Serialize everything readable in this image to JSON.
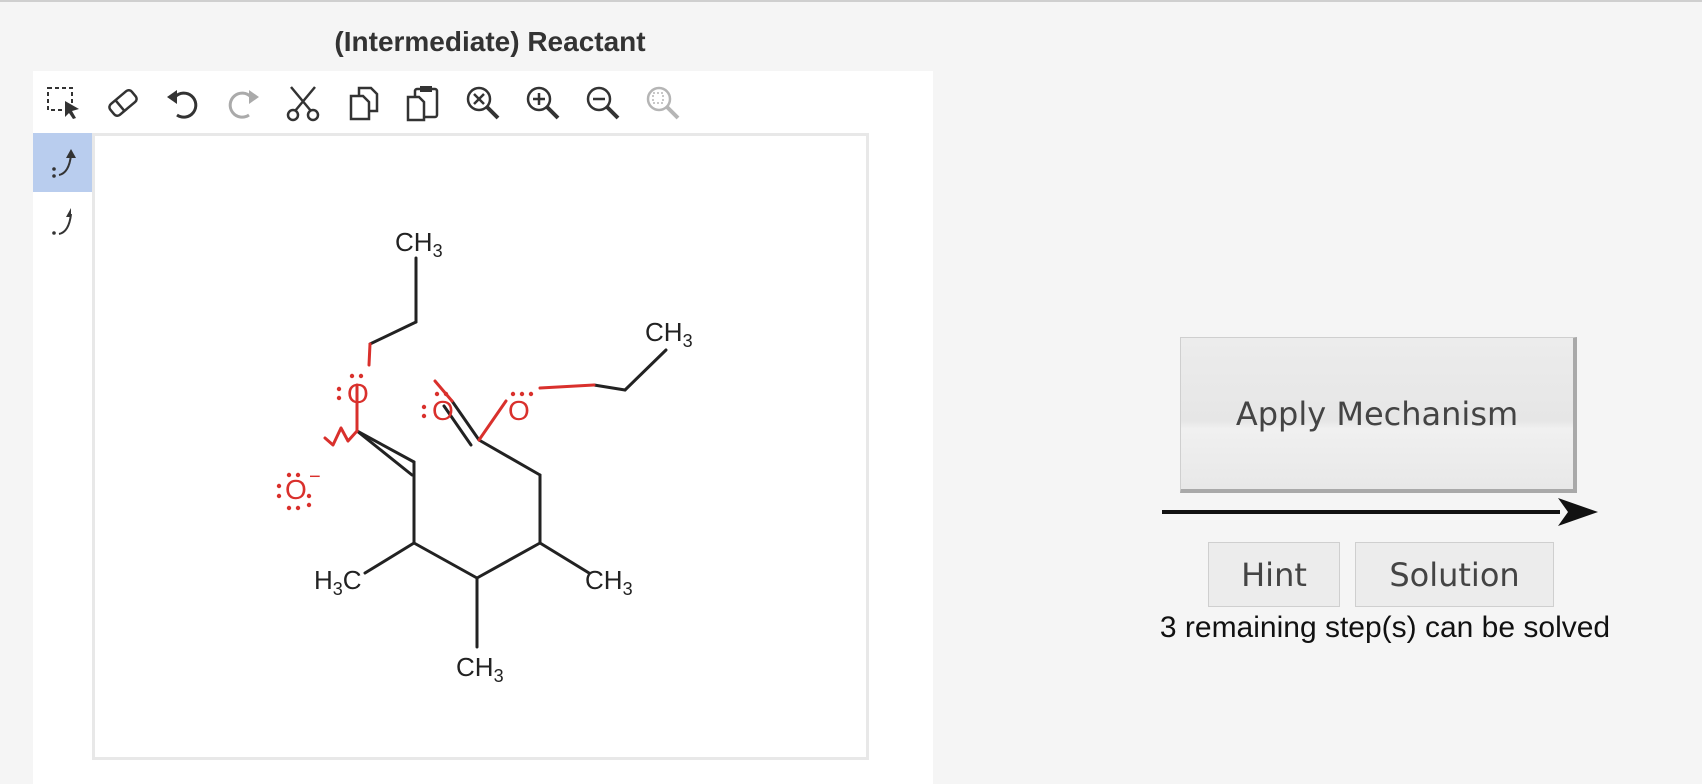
{
  "panel": {
    "title": "(Intermediate) Reactant"
  },
  "toolbar": {
    "tools": [
      {
        "name": "select-tool",
        "icon": "lasso-select-icon"
      },
      {
        "name": "erase-tool",
        "icon": "eraser-icon"
      },
      {
        "name": "undo-tool",
        "icon": "undo-icon"
      },
      {
        "name": "redo-tool",
        "icon": "redo-icon",
        "disabled": true
      },
      {
        "name": "cut-tool",
        "icon": "scissors-icon"
      },
      {
        "name": "copy-tool",
        "icon": "copy-icon"
      },
      {
        "name": "paste-tool",
        "icon": "paste-icon"
      },
      {
        "name": "zoom-fit-tool",
        "icon": "zoom-clear-icon"
      },
      {
        "name": "zoom-in-tool",
        "icon": "zoom-in-icon"
      },
      {
        "name": "zoom-out-tool",
        "icon": "zoom-out-icon"
      },
      {
        "name": "zoom-reset-tool",
        "icon": "zoom-reset-icon",
        "disabled": true
      }
    ]
  },
  "side_tools": [
    {
      "name": "electron-pair-arrow-tool",
      "icon": "curved-arrow-pair-icon",
      "active": true
    },
    {
      "name": "single-electron-arrow-tool",
      "icon": "curved-arrow-single-icon",
      "active": false
    }
  ],
  "molecule": {
    "labels": {
      "ch3_top": "CH3",
      "ch3_right": "CH3",
      "h3c_left": "H3C",
      "ch3_mid_right": "CH3",
      "ch3_bottom": "CH3",
      "o_ether_left": "O",
      "o_carbonyl": "O",
      "o_ether_right": "O",
      "o_anion": "O",
      "charge_minus": "−"
    },
    "colors": {
      "bond": "#222222",
      "oxygen": "#d9302c"
    }
  },
  "actions": {
    "apply_label": "Apply Mechanism",
    "hint_label": "Hint",
    "solution_label": "Solution"
  },
  "status": {
    "text": "3 remaining step(s) can be solved"
  }
}
